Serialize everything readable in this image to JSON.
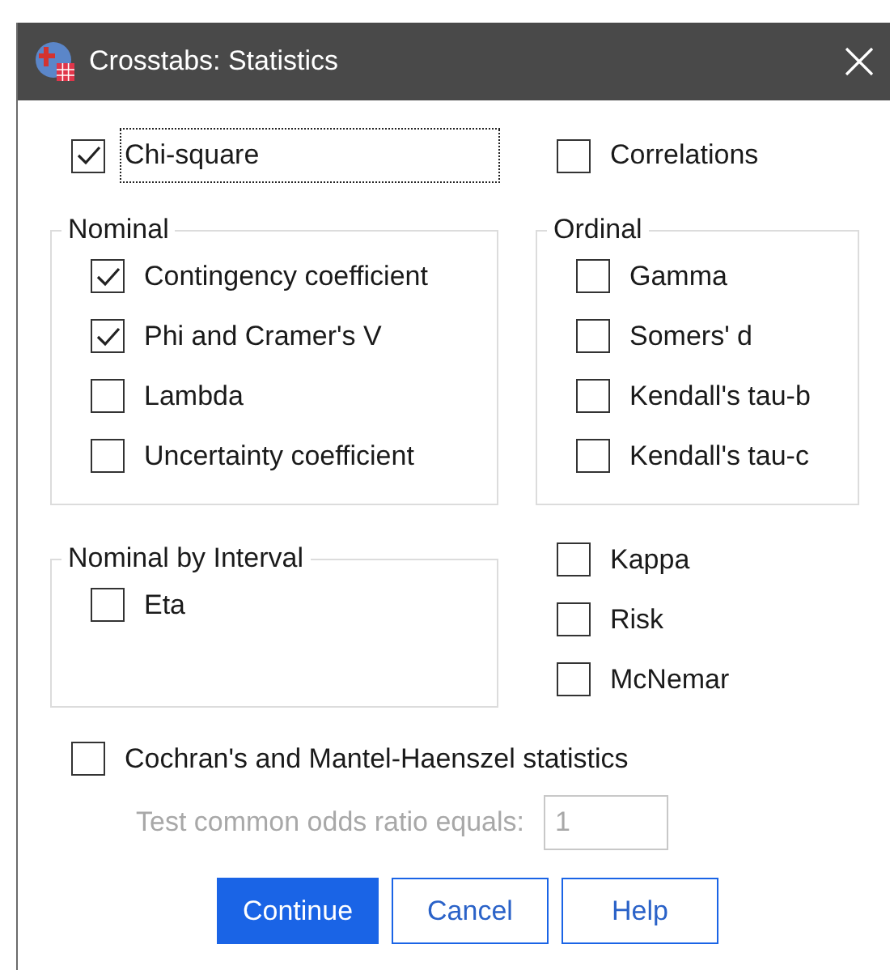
{
  "window": {
    "title": "Crosstabs: Statistics"
  },
  "chi_square": {
    "label": "Chi-square",
    "checked": true,
    "focused": true
  },
  "correlations": {
    "label": "Correlations",
    "checked": false
  },
  "nominal": {
    "title": "Nominal",
    "items": [
      {
        "label": "Contingency coefficient",
        "checked": true
      },
      {
        "label": "Phi and Cramer's V",
        "checked": true
      },
      {
        "label": "Lambda",
        "checked": false
      },
      {
        "label": "Uncertainty coefficient",
        "checked": false
      }
    ]
  },
  "ordinal": {
    "title": "Ordinal",
    "items": [
      {
        "label": "Gamma",
        "checked": false
      },
      {
        "label": "Somers' d",
        "checked": false
      },
      {
        "label": "Kendall's tau-b",
        "checked": false
      },
      {
        "label": "Kendall's tau-c",
        "checked": false
      }
    ]
  },
  "nominal_by_interval": {
    "title": "Nominal by Interval",
    "items": [
      {
        "label": "Eta",
        "checked": false
      }
    ]
  },
  "other": [
    {
      "label": "Kappa",
      "checked": false
    },
    {
      "label": "Risk",
      "checked": false
    },
    {
      "label": "McNemar",
      "checked": false
    }
  ],
  "cochran": {
    "label": "Cochran's and Mantel-Haenszel statistics",
    "checked": false
  },
  "odds_ratio": {
    "label": "Test common odds ratio equals:",
    "value": "1",
    "disabled": true
  },
  "buttons": [
    {
      "label": "Continue",
      "default": true
    },
    {
      "label": "Cancel",
      "default": false
    },
    {
      "label": "Help",
      "default": false
    }
  ]
}
